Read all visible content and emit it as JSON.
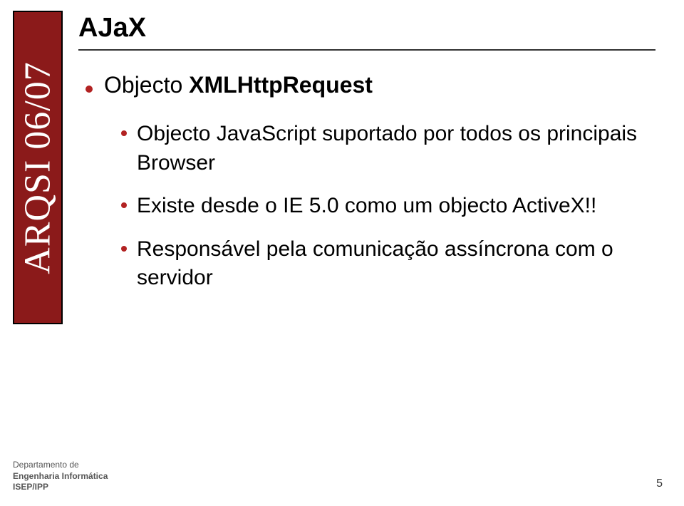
{
  "sidebar": {
    "label": "ARQSI 06/07"
  },
  "slide": {
    "title": "AJaX",
    "main_bullet_prefix": "Objecto ",
    "main_bullet_bold": "XMLHttpRequest",
    "sub_bullets": [
      "Objecto JavaScript suportado por todos os principais Browser",
      "Existe desde o IE 5.0 como um objecto ActiveX!!",
      "Responsável pela comunicação assíncrona com o servidor"
    ]
  },
  "footer": {
    "line1": "Departamento de",
    "line2": "Engenharia Informática",
    "line3": "ISEP/IPP"
  },
  "page_number": "5"
}
